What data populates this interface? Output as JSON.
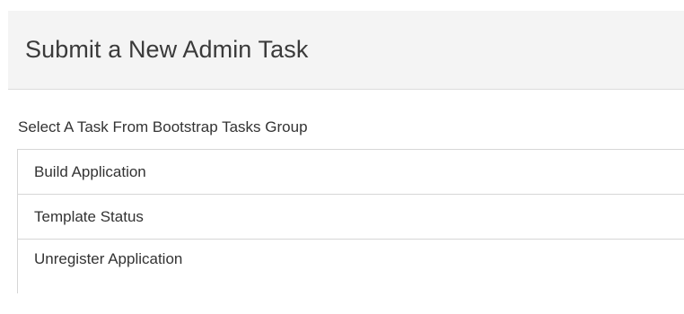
{
  "panel": {
    "title": "Submit a New Admin Task"
  },
  "task_group": {
    "label": "Select A Task From Bootstrap Tasks Group",
    "items": [
      {
        "label": "Build Application"
      },
      {
        "label": "Template Status"
      },
      {
        "label": "Unregister Application"
      }
    ]
  }
}
